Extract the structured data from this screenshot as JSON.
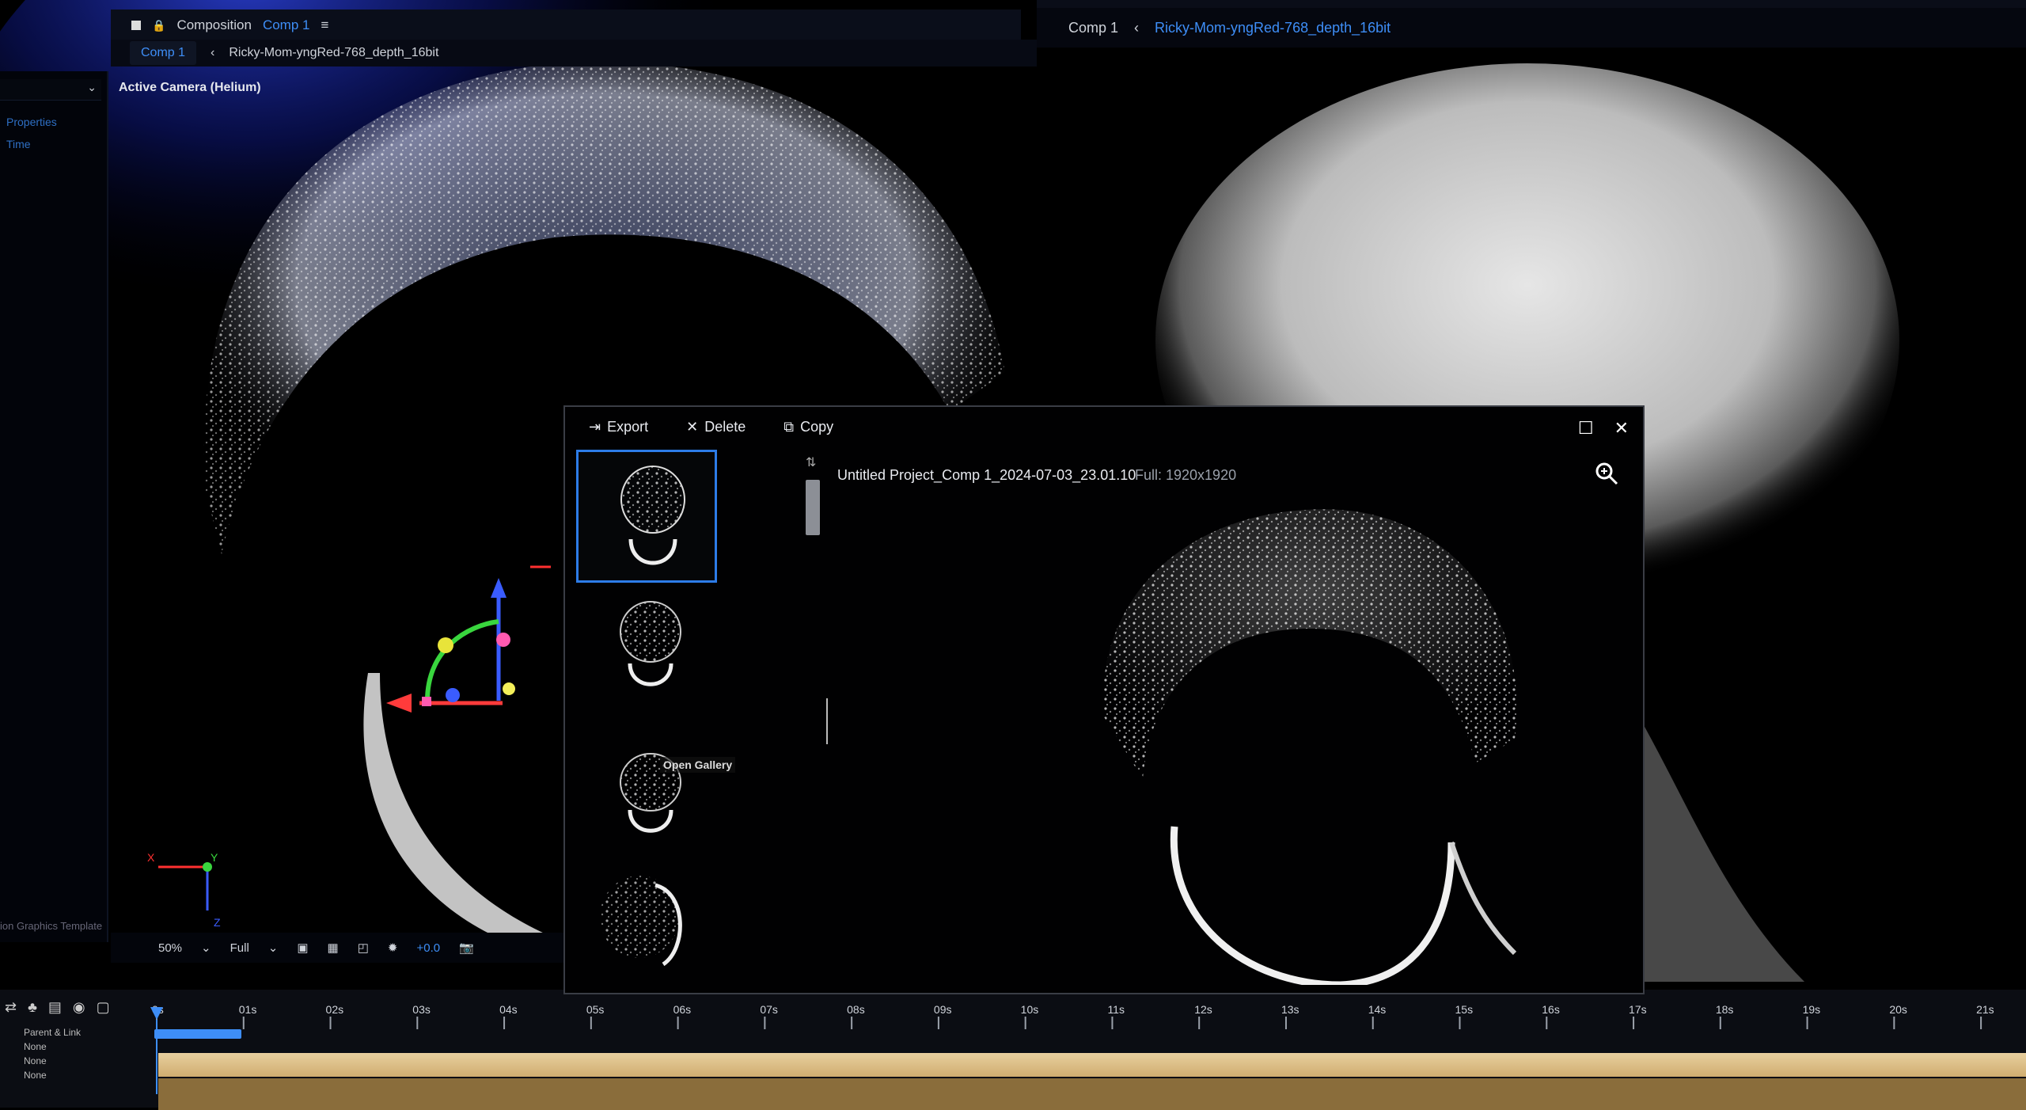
{
  "composition_header": {
    "prefix": "Composition",
    "name": "Comp 1"
  },
  "comp_tabs": {
    "active": "Comp 1",
    "layer": "Ricky-Mom-yngRed-768_depth_16bit"
  },
  "right_panel": {
    "tab_comp": "Comp 1",
    "tab_layer": "Ricky-Mom-yngRed-768_depth_16bit"
  },
  "sidebar": {
    "items": [
      "Properties",
      "Time"
    ]
  },
  "viewer": {
    "camera_label": "Active Camera (Helium)",
    "zoom": "50%",
    "resolution": "Full",
    "exposure": "+0.0",
    "graphics_label": "ion Graphics Template"
  },
  "gallery": {
    "toolbar": {
      "export_label": "Export",
      "delete_label": "Delete",
      "copy_label": "Copy"
    },
    "filename": "Untitled Project_Comp 1_2024-07-03_23.01.10",
    "resolution": "Full: 1920x1920",
    "tooltip": "Open Gallery",
    "selected_index": 0
  },
  "timeline": {
    "ticks": [
      "0s",
      "01s",
      "02s",
      "03s",
      "04s",
      "05s",
      "06s",
      "07s",
      "08s",
      "09s",
      "10s",
      "11s",
      "12s",
      "13s",
      "14s",
      "15s",
      "16s",
      "17s",
      "18s",
      "19s",
      "20s",
      "21s"
    ],
    "parent_header": "Parent & Link",
    "parent_values": [
      "None",
      "None",
      "None"
    ]
  },
  "colors": {
    "accent": "#3e8ef7",
    "selection": "#2d7ce8",
    "layer_bar": "#e2c68f"
  },
  "icons": [
    "export-icon",
    "delete-icon",
    "copy-icon",
    "maximize-icon",
    "close-icon",
    "zoom-in-icon",
    "camera-icon",
    "gizmo-icon"
  ]
}
